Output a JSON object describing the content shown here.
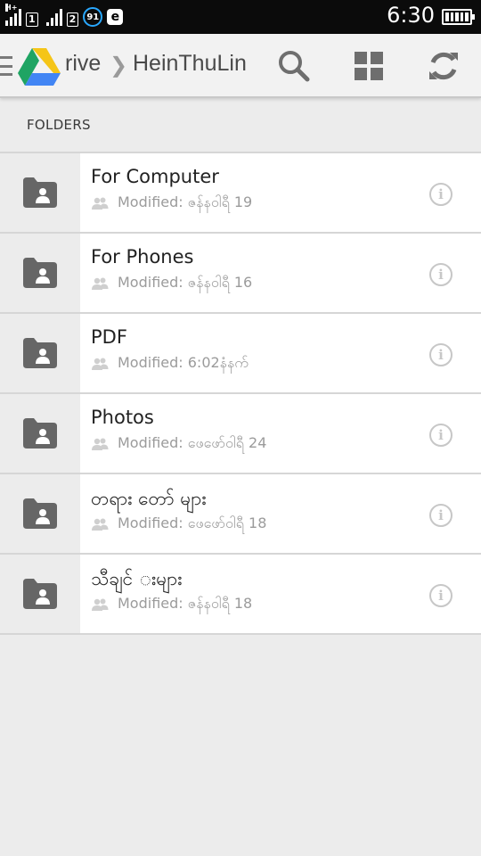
{
  "status_bar": {
    "network_tag": "H+",
    "sim1_label": "1",
    "sim2_label": "2",
    "notification_badge": "91",
    "app_letter": "e",
    "time": "6:30",
    "battery_level": 1.0
  },
  "action_bar": {
    "app_title": "rive",
    "separator": "❯",
    "folder_title": "HeinThuLin",
    "icons": [
      "menu-icon",
      "drive-logo-icon",
      "search-icon",
      "grid-view-icon",
      "refresh-icon"
    ]
  },
  "section": {
    "label": "FOLDERS"
  },
  "folders": [
    {
      "name": "For Computer",
      "modified": "Modified: ဇန်နဝါရီ 19"
    },
    {
      "name": "For Phones",
      "modified": "Modified: ဇန်နဝါရီ 16"
    },
    {
      "name": "PDF",
      "modified": "Modified: 6:02နံနက်"
    },
    {
      "name": "Photos",
      "modified": "Modified: ဖေဖော်ဝါရီ 24"
    },
    {
      "name": "တရား တော် များ",
      "modified": "Modified: ဖေဖော်ဝါရီ 18"
    },
    {
      "name": "သီချင် းများ",
      "modified": "Modified: ဇန်နဝါရီ 18"
    }
  ],
  "colors": {
    "status_bar_bg": "#0b0b0b",
    "action_bar_bg": "#f2f2f2",
    "page_bg": "#ececec",
    "folder_icon": "#666666",
    "meta_text": "#9b9b9b"
  }
}
